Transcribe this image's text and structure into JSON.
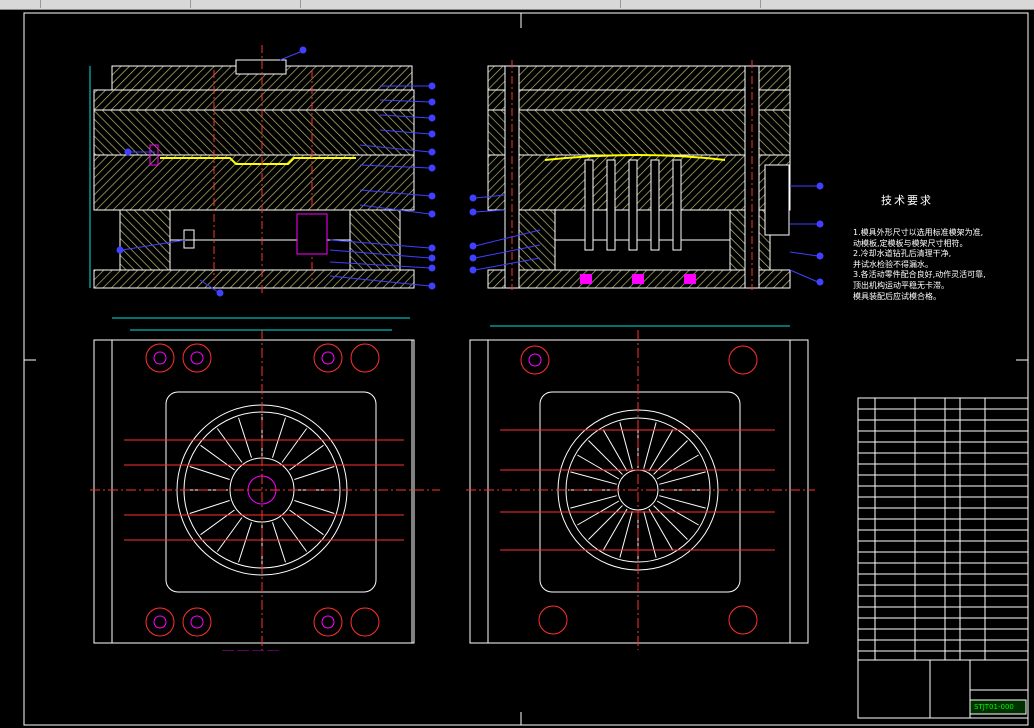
{
  "window": {
    "title": ""
  },
  "notes": {
    "title": "技术要求",
    "lines": [
      "1.模具外形尺寸以选用标准模架为准,",
      "  动模板,定模板与模架尺寸相符。",
      "2.冷却水道钻孔后清理干净,",
      "  并试水检验不得漏水。",
      "3.各活动零件配合良好,动作灵活可靠,",
      "  顶出机构运动平稳无卡滞。",
      "  模具装配后应试模合格。"
    ]
  },
  "title_block": {
    "drawing_no": "STJT01-000",
    "drawing_no_label": "STJT01-000"
  },
  "colors": {
    "background": "#000000",
    "outline": "#ffffff",
    "hatch": "#c8c878",
    "center_line": "#ff3030",
    "dimension": "#00e0e0",
    "leader": "#4040ff",
    "part": "#ffff00",
    "accent": "#ff00ff",
    "green": "#00ff00"
  }
}
